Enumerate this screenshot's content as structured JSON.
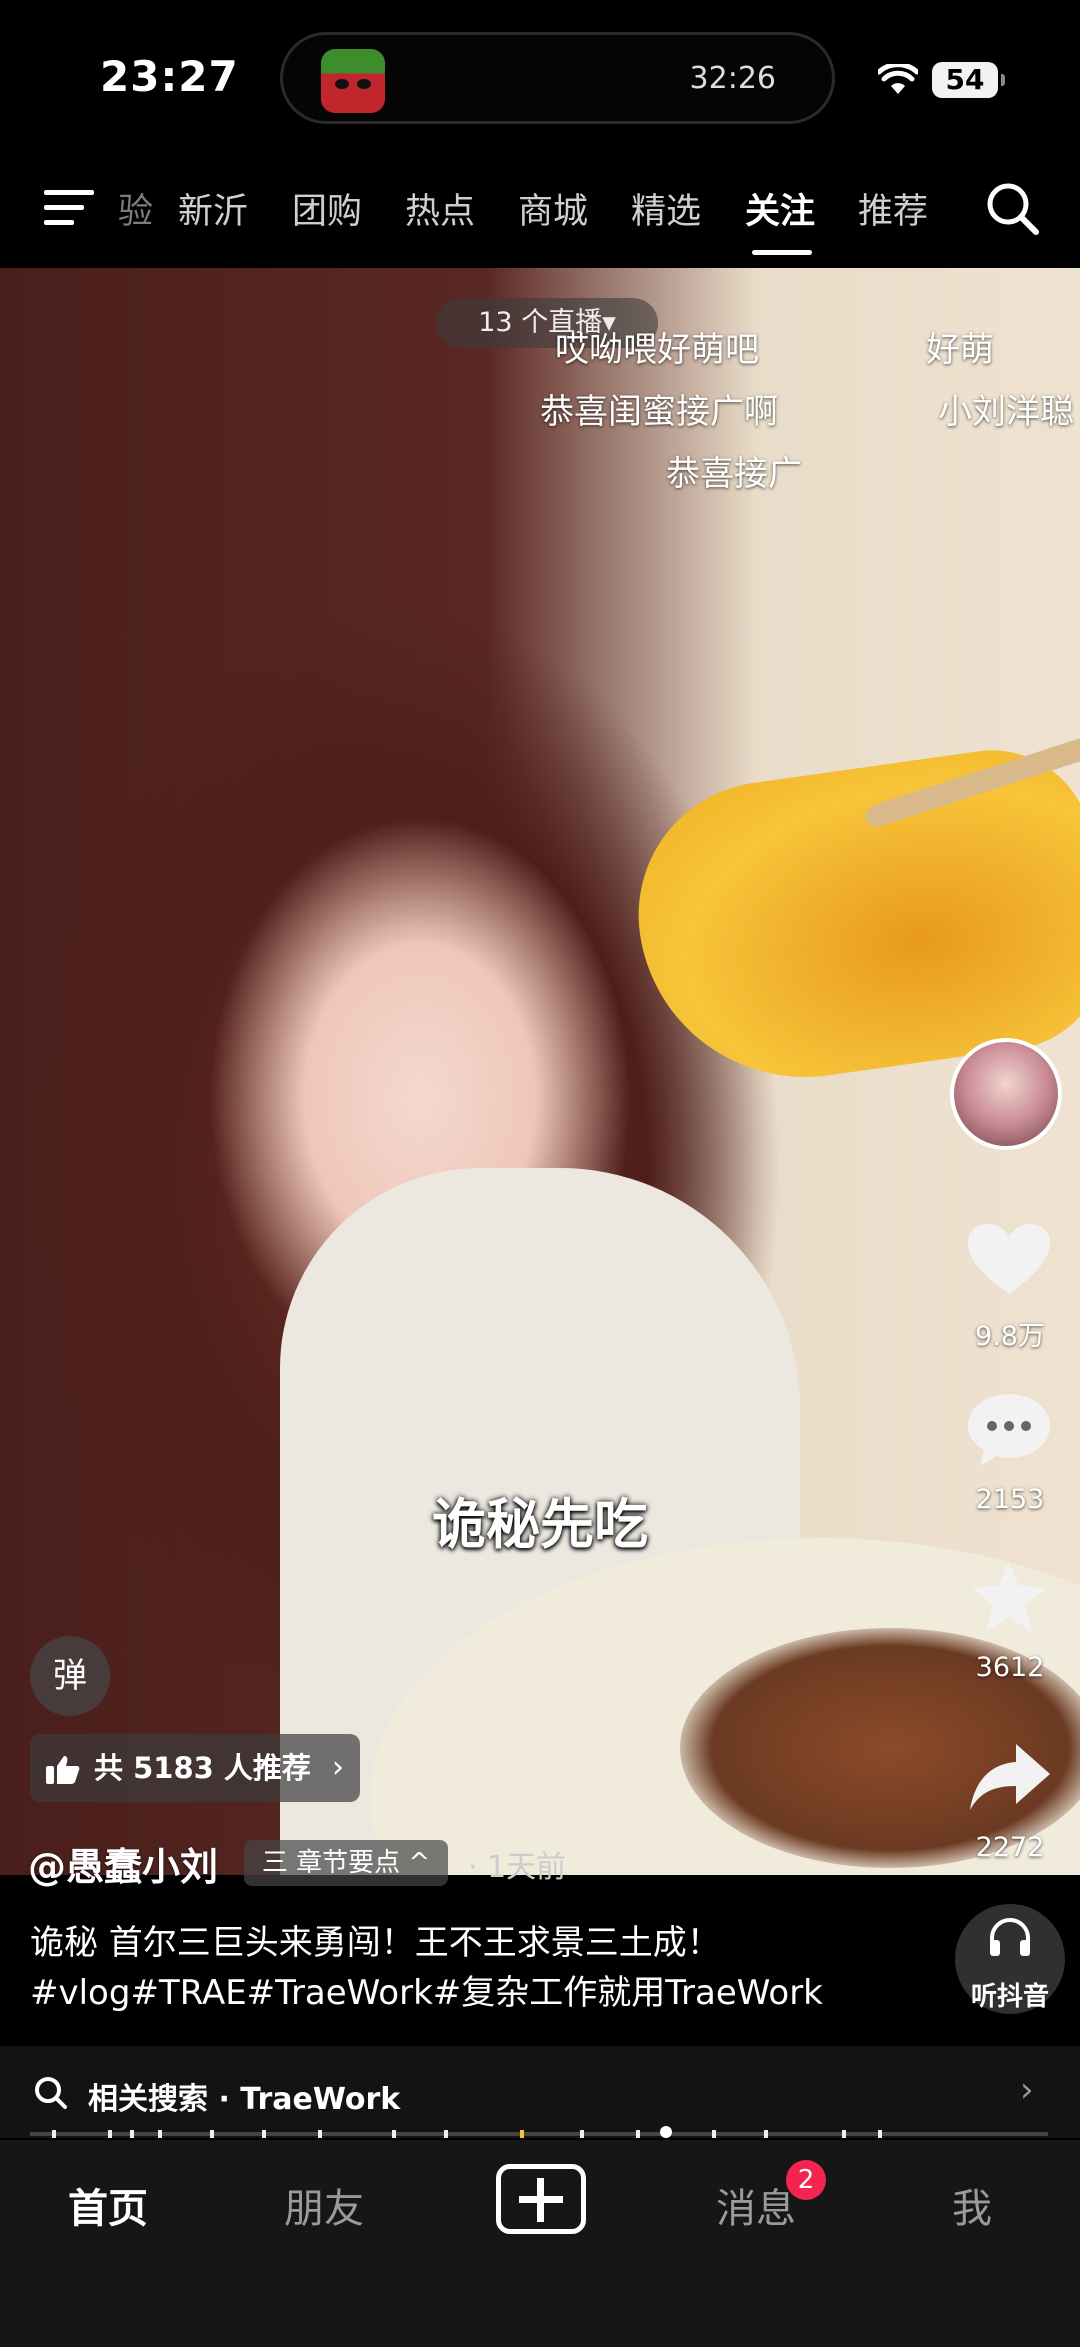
{
  "status_bar": {
    "time": "23:27",
    "island_timer": "32:26",
    "battery": "54"
  },
  "top_nav": {
    "partial_tab": "验",
    "tabs": [
      "新沂",
      "团购",
      "热点",
      "商城",
      "精选",
      "关注",
      "推荐"
    ],
    "active_tab": "关注"
  },
  "video": {
    "live_badge": "13 个直播▾",
    "danmaku": [
      "哎呦喂好萌吧",
      "好萌",
      "恭喜闺蜜接广啊",
      "小刘洋聪",
      "恭喜接广"
    ],
    "subtitle": "诡秘先吃"
  },
  "actions": {
    "likes": "9.8万",
    "comments": "2153",
    "favorites": "3612",
    "shares": "2272"
  },
  "danmaku_toggle": "弹",
  "recommend": {
    "text": "共 5183 人推荐",
    "chevron": "›"
  },
  "author": {
    "name": "@愚蠢小刘",
    "chapter": "三 章节要点 ^",
    "time": "· 1天前"
  },
  "caption": {
    "line1": "诡秘 首尔三巨头来勇闯！王不王求景三土成！",
    "line2": "#vlog#TRAE#TraeWork#复杂工作就用TraeWork"
  },
  "listen": {
    "label": "听抖音"
  },
  "related_search": {
    "label": "相关搜索 · TraeWork"
  },
  "bottom_tabs": {
    "home": "首页",
    "friends": "朋友",
    "messages": "消息",
    "me": "我",
    "messages_badge": "2"
  },
  "colors": {
    "accent": "#f4244f",
    "background": "#000000"
  }
}
